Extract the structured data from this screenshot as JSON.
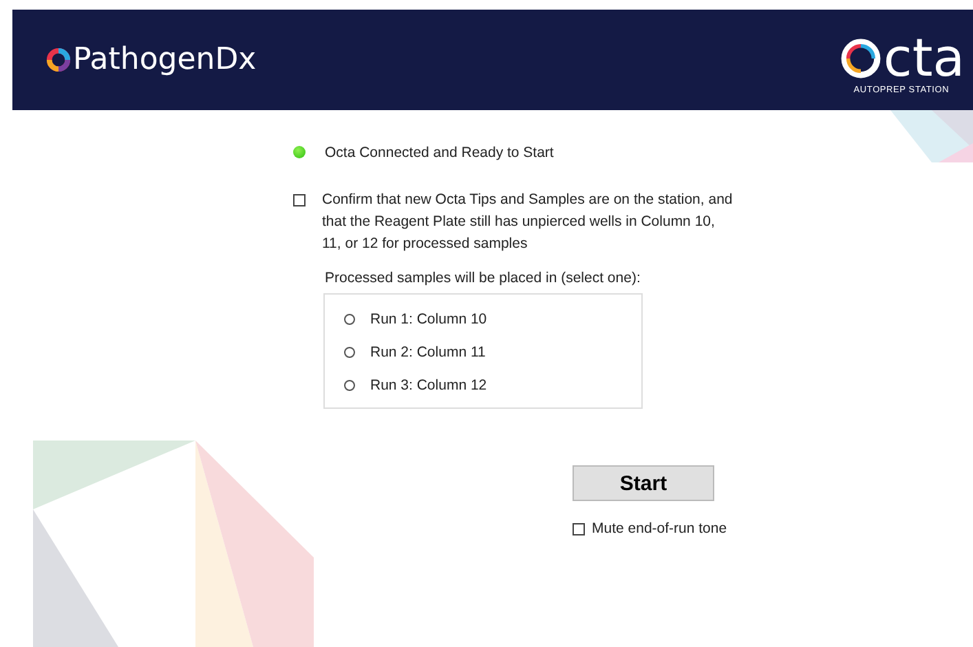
{
  "header": {
    "brand": "PathogenDx",
    "product": "cta",
    "product_subtitle": "AUTOPREP STATION"
  },
  "status": {
    "text": "Octa Connected and Ready to Start",
    "connected": true
  },
  "confirm": {
    "text": "Confirm that new Octa Tips and Samples are on the station, and that the Reagent Plate still has unpierced wells in Column 10, 11, or 12 for processed samples",
    "checked": false
  },
  "placement": {
    "label": "Processed samples will be placed in (select one):",
    "options": [
      {
        "label": "Run 1: Column 10",
        "selected": false
      },
      {
        "label": "Run 2: Column 11",
        "selected": false
      },
      {
        "label": "Run 3: Column 12",
        "selected": false
      }
    ]
  },
  "start_button": "Start",
  "mute": {
    "label": "Mute end-of-run tone",
    "checked": false
  }
}
